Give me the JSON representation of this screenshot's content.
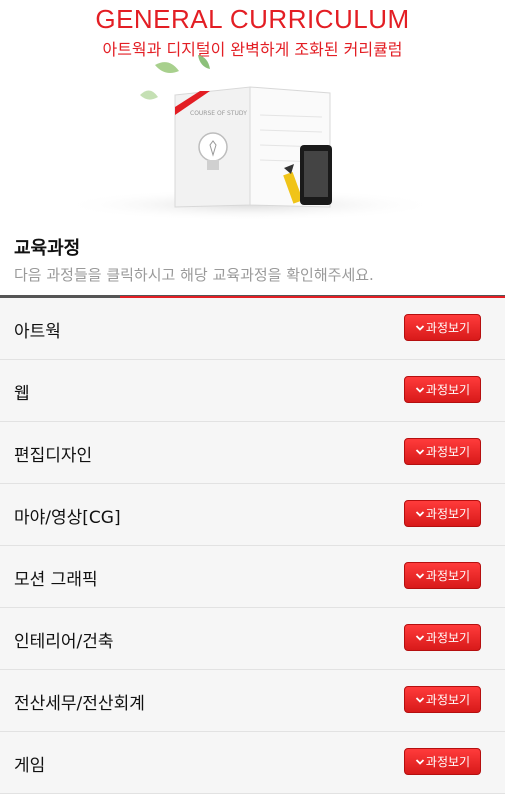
{
  "hero": {
    "title": "GENERAL CURRICULUM",
    "subtitle": "아트웍과 디지털이 완벽하게 조화된 커리큘럼",
    "book_label": "COURSE OF STUDY"
  },
  "section": {
    "title": "교육과정",
    "description": "다음 과정들을 클릭하시고 해당 교육과정을 확인해주세요."
  },
  "courses": [
    {
      "label": "아트웍",
      "button": "과정보기"
    },
    {
      "label": "웹",
      "button": "과정보기"
    },
    {
      "label": "편집디자인",
      "button": "과정보기"
    },
    {
      "label": "마야/영상[CG]",
      "button": "과정보기"
    },
    {
      "label": "모션 그래픽",
      "button": "과정보기"
    },
    {
      "label": "인테리어/건축",
      "button": "과정보기"
    },
    {
      "label": "전산세무/전산회계",
      "button": "과정보기"
    },
    {
      "label": "게임",
      "button": "과정보기"
    }
  ],
  "colors": {
    "accent": "#e31e24",
    "button": "#e52424"
  }
}
